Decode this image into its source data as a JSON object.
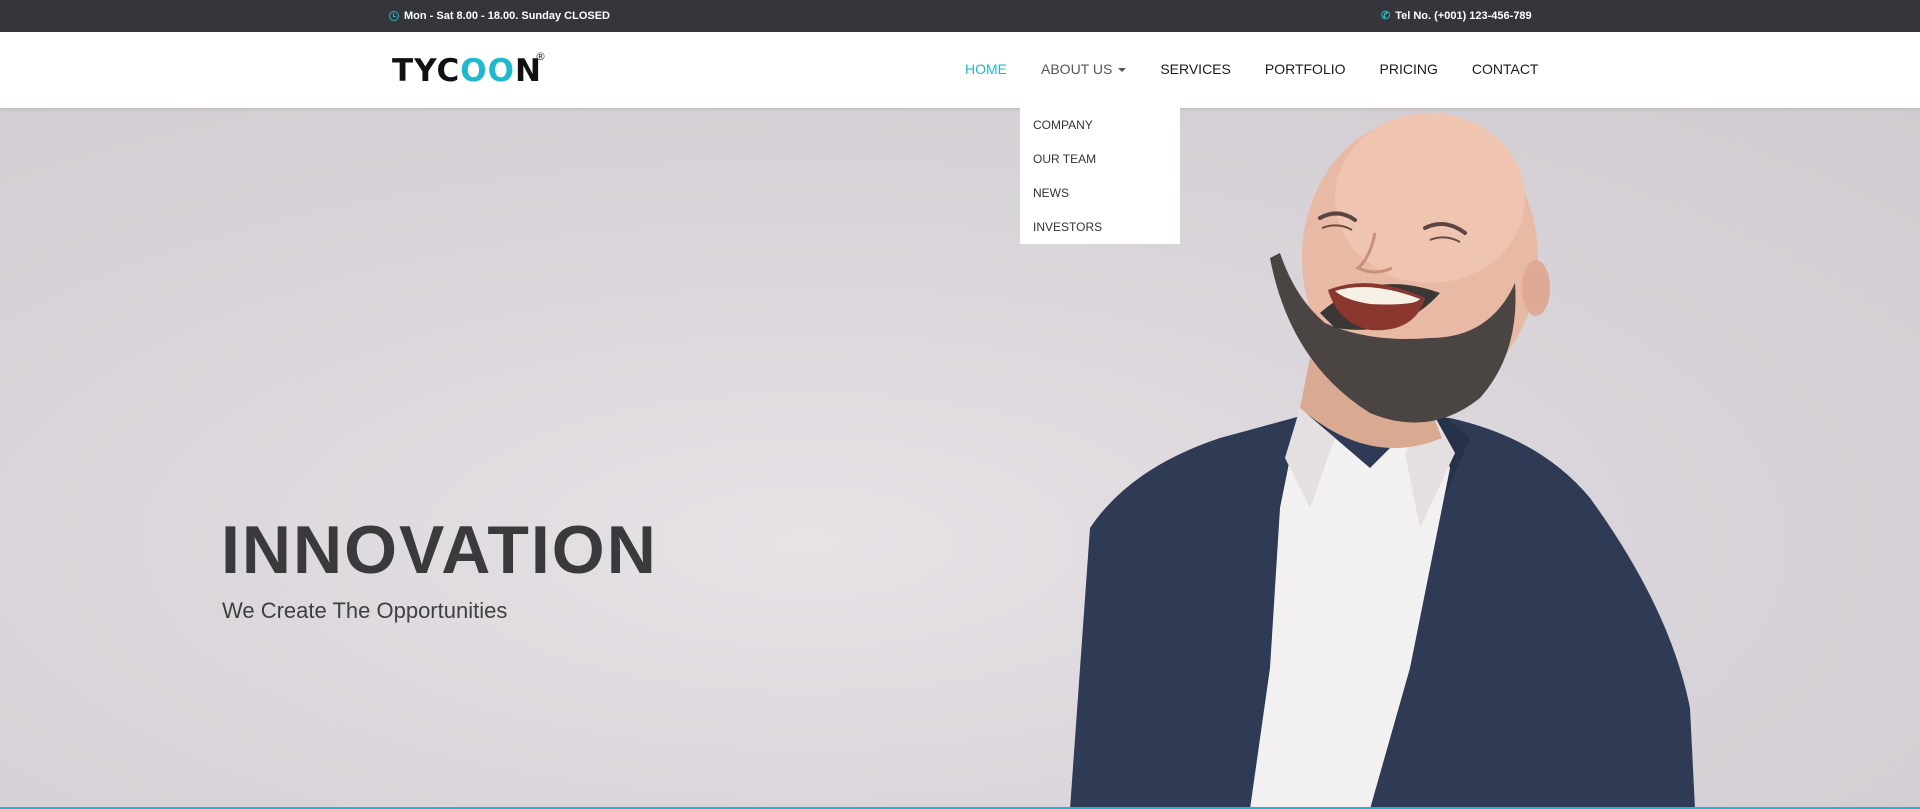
{
  "topbar": {
    "hours_icon": "clock-icon",
    "hours": "Mon - Sat 8.00 - 18.00. Sunday CLOSED",
    "phone_icon": "phone-icon",
    "phone": "Tel No. (+001) 123-456-789"
  },
  "brand": {
    "logo_start": "TYC",
    "logo_accent": "OO",
    "logo_end": "N",
    "registered": "®",
    "accent_color": "#1fb8cf"
  },
  "nav": {
    "items": [
      {
        "label": "HOME",
        "active": true
      },
      {
        "label": "ABOUT US",
        "has_dropdown": true,
        "open": true
      },
      {
        "label": "SERVICES"
      },
      {
        "label": "PORTFOLIO"
      },
      {
        "label": "PRICING"
      },
      {
        "label": "CONTACT"
      }
    ]
  },
  "dropdown": {
    "items": [
      "COMPANY",
      "OUR TEAM",
      "NEWS",
      "INVESTORS"
    ]
  },
  "hero": {
    "title": "INNOVATION",
    "subtitle": "We Create The Opportunities"
  }
}
